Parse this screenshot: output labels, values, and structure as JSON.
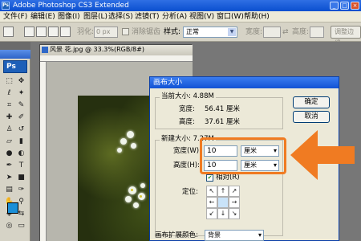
{
  "app": {
    "title": "Adobe Photoshop CS3 Extended",
    "logo": "Ps"
  },
  "window_controls": [
    "_",
    "□",
    "×"
  ],
  "menu": [
    "文件(F)",
    "编辑(E)",
    "图像(I)",
    "图层(L)",
    "选择(S)",
    "滤镜(T)",
    "分析(A)",
    "视图(V)",
    "窗口(W)",
    "帮助(H)"
  ],
  "options_bar": {
    "feather_label": "羽化:",
    "feather_value": "0 px",
    "antialias_label": "消除锯齿",
    "style_label": "样式:",
    "style_value": "正常",
    "width_label": "宽度:",
    "height_label": "高度:",
    "refine_edge": "调整边缘"
  },
  "toolbox": {
    "badge": "Ps",
    "foreground_color": "#1b8fd7"
  },
  "document": {
    "title": "风景 花.jpg @ 33.3%(RGB/8#)"
  },
  "dialog": {
    "title": "画布大小",
    "current_size_label": "当前大小: 4.88M",
    "current_width_label": "宽度:",
    "current_width_value": "56.41 厘米",
    "current_height_label": "高度:",
    "current_height_value": "37.61 厘米",
    "new_size_label": "新建大小: 7.27M",
    "width_label": "宽度(W):",
    "width_value": "10",
    "width_unit": "厘米",
    "height_label": "高度(H):",
    "height_value": "10",
    "height_unit": "厘米",
    "relative_label": "相对(R)",
    "relative_checked": true,
    "anchor_label": "定位:",
    "anchor_arrows": [
      "↖",
      "↑",
      "↗",
      "←",
      "",
      "→",
      "↙",
      "↓",
      "↘"
    ],
    "ok_button": "确定",
    "cancel_button": "取消",
    "extension_color_label": "画布扩展颜色:",
    "extension_color_value": "背景"
  },
  "annotation": {
    "highlight_color": "#f07b22"
  }
}
